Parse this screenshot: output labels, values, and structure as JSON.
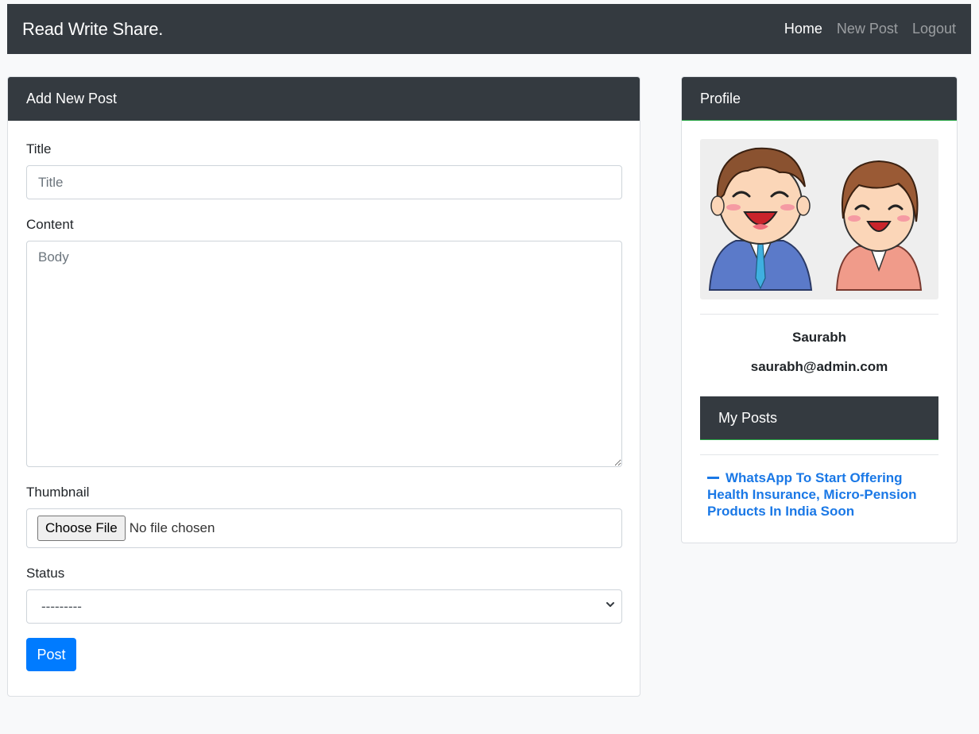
{
  "navbar": {
    "brand": "Read Write Share.",
    "links": [
      {
        "label": "Home",
        "active": true
      },
      {
        "label": "New Post",
        "active": false
      },
      {
        "label": "Logout",
        "active": false
      }
    ]
  },
  "post_form": {
    "header": "Add New Post",
    "title_label": "Title",
    "title_placeholder": "Title",
    "content_label": "Content",
    "content_placeholder": "Body",
    "thumbnail_label": "Thumbnail",
    "file_button": "Choose File",
    "file_status": "No file chosen",
    "status_label": "Status",
    "status_selected": "---------",
    "submit_label": "Post"
  },
  "profile": {
    "header": "Profile",
    "name": "Saurabh",
    "email": "saurabh@admin.com",
    "my_posts_header": "My Posts",
    "posts": [
      {
        "title": "WhatsApp To Start Offering Health Insurance, Micro-Pension Products In India Soon"
      }
    ]
  },
  "colors": {
    "navbar_bg": "#343a40",
    "primary": "#007bff",
    "link": "#1a78e6",
    "accent_border": "#28a745"
  }
}
